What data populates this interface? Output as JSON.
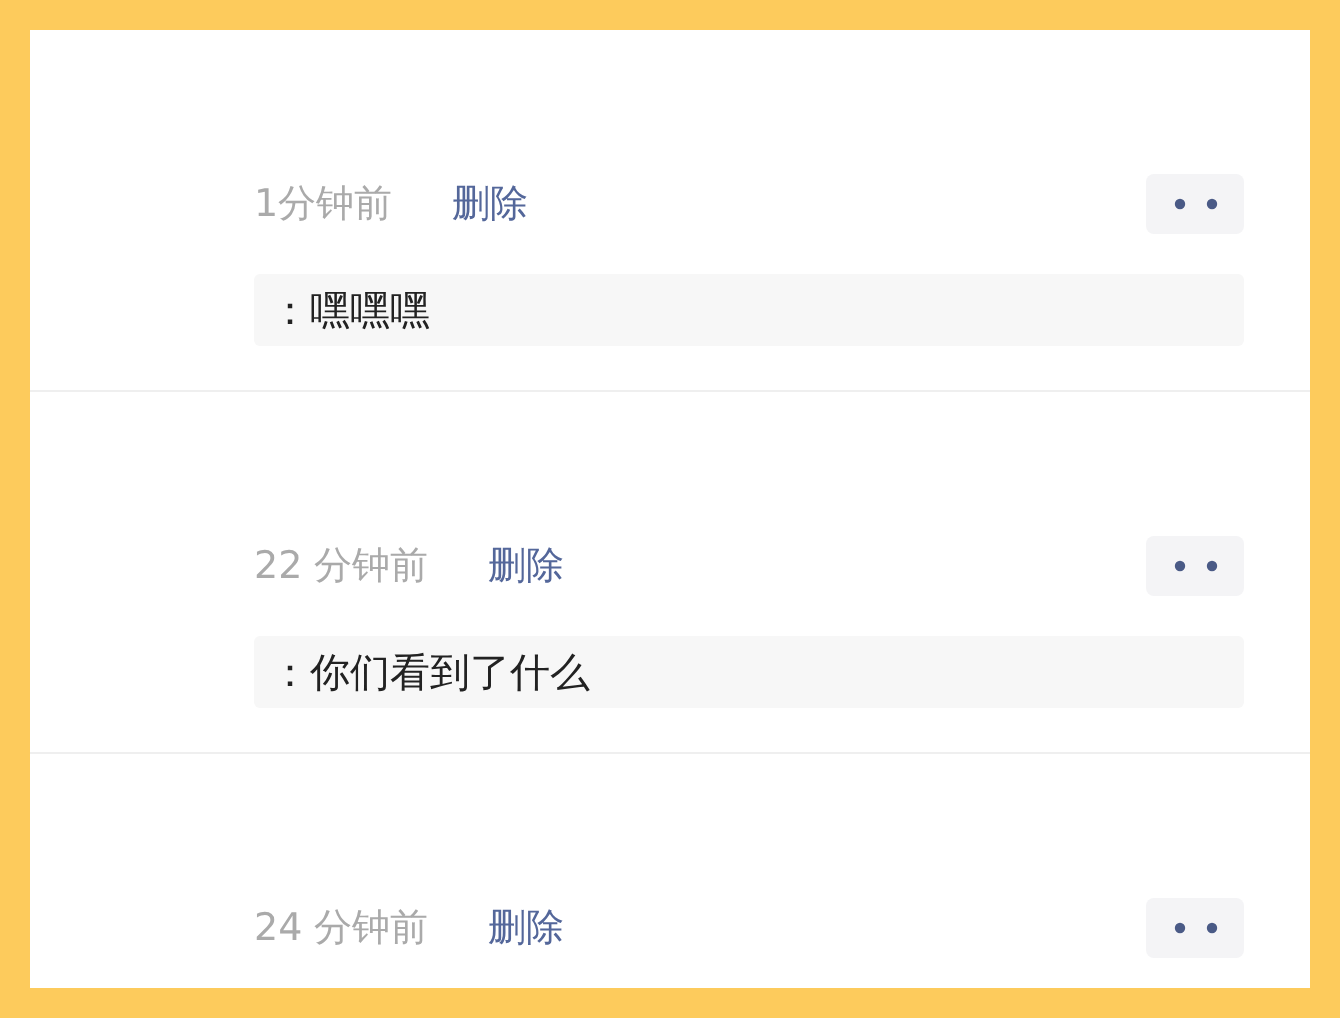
{
  "comments": [
    {
      "time": "1分钟前",
      "delete_label": "删除",
      "text": "：嘿嘿嘿"
    },
    {
      "time": "22 分钟前",
      "delete_label": "删除",
      "text": "：你们看到了什么"
    },
    {
      "time": "24 分钟前",
      "delete_label": "删除"
    }
  ]
}
